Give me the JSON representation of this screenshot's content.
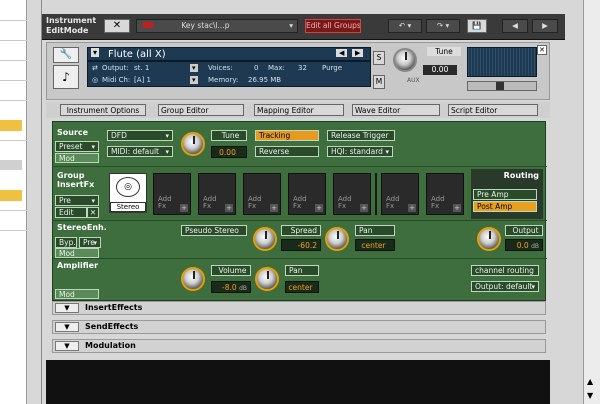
{
  "topbar": {
    "title": "Instrument\nEditMode",
    "close_label": "✕",
    "instrument_select": "Key stac\\l...p",
    "edit_all_groups": "Edit all Groups",
    "undo": "↶ ▾",
    "redo": "↷ ▾",
    "save_icon": "💾",
    "prev": "◀",
    "next": "▶"
  },
  "header": {
    "instrument_name": "Flute (all X)",
    "output_label": "Output:",
    "output_value": "st. 1",
    "voices_label": "Voices:",
    "voices_value": "0",
    "max_label": "Max:",
    "max_value": "32",
    "purge_label": "Purge",
    "midi_label": "Midi Ch:",
    "midi_value": "[A] 1",
    "memory_label": "Memory:",
    "memory_value": "26.95 MB",
    "s_label": "S",
    "m_label": "M",
    "tune_label": "Tune",
    "tune_value": "0.00",
    "aux_label": "AUX"
  },
  "tabs": {
    "instrument_options": "Instrument Options",
    "group_editor": "Group Editor",
    "mapping_editor": "Mapping Editor",
    "wave_editor": "Wave Editor",
    "script_editor": "Script Editor"
  },
  "source": {
    "title": "Source",
    "preset": "Preset",
    "mod": "Mod",
    "dfd": "DFD",
    "midi_default": "MIDI: default",
    "tune_label": "Tune",
    "tune_value": "0.00",
    "tracking": "Tracking",
    "reverse": "Reverse",
    "release_trigger": "Release Trigger",
    "hq": "HQI: standard"
  },
  "group_fx": {
    "title": "Group\nInsertFx",
    "pre": "Pre",
    "edit": "Edit",
    "close": "✕",
    "stereo": "Stereo",
    "add_fx": "Add\nFx",
    "plus": "+",
    "routing": "Routing",
    "pre_amp": "Pre Amp",
    "post_amp": "Post Amp"
  },
  "stereo": {
    "title": "StereoEnh.",
    "byp": "Byp.",
    "pre": "Pre",
    "mod": "Mod",
    "pseudo": "Pseudo Stereo",
    "spread_label": "Spread",
    "spread_value": "-60.2",
    "pan_label": "Pan",
    "pan_value": "center",
    "output_label": "Output",
    "output_value": "0.0",
    "db": "dB"
  },
  "amp": {
    "title": "Amplifier",
    "mod": "Mod",
    "volume_label": "Volume",
    "volume_value": "-8.0",
    "db": "dB",
    "pan_label": "Pan",
    "pan_value": "center",
    "channel_routing": "channel routing",
    "output_default": "Output: default"
  },
  "sections": {
    "insert": "InsertEffects",
    "send": "SendEffects",
    "modulation": "Modulation"
  }
}
